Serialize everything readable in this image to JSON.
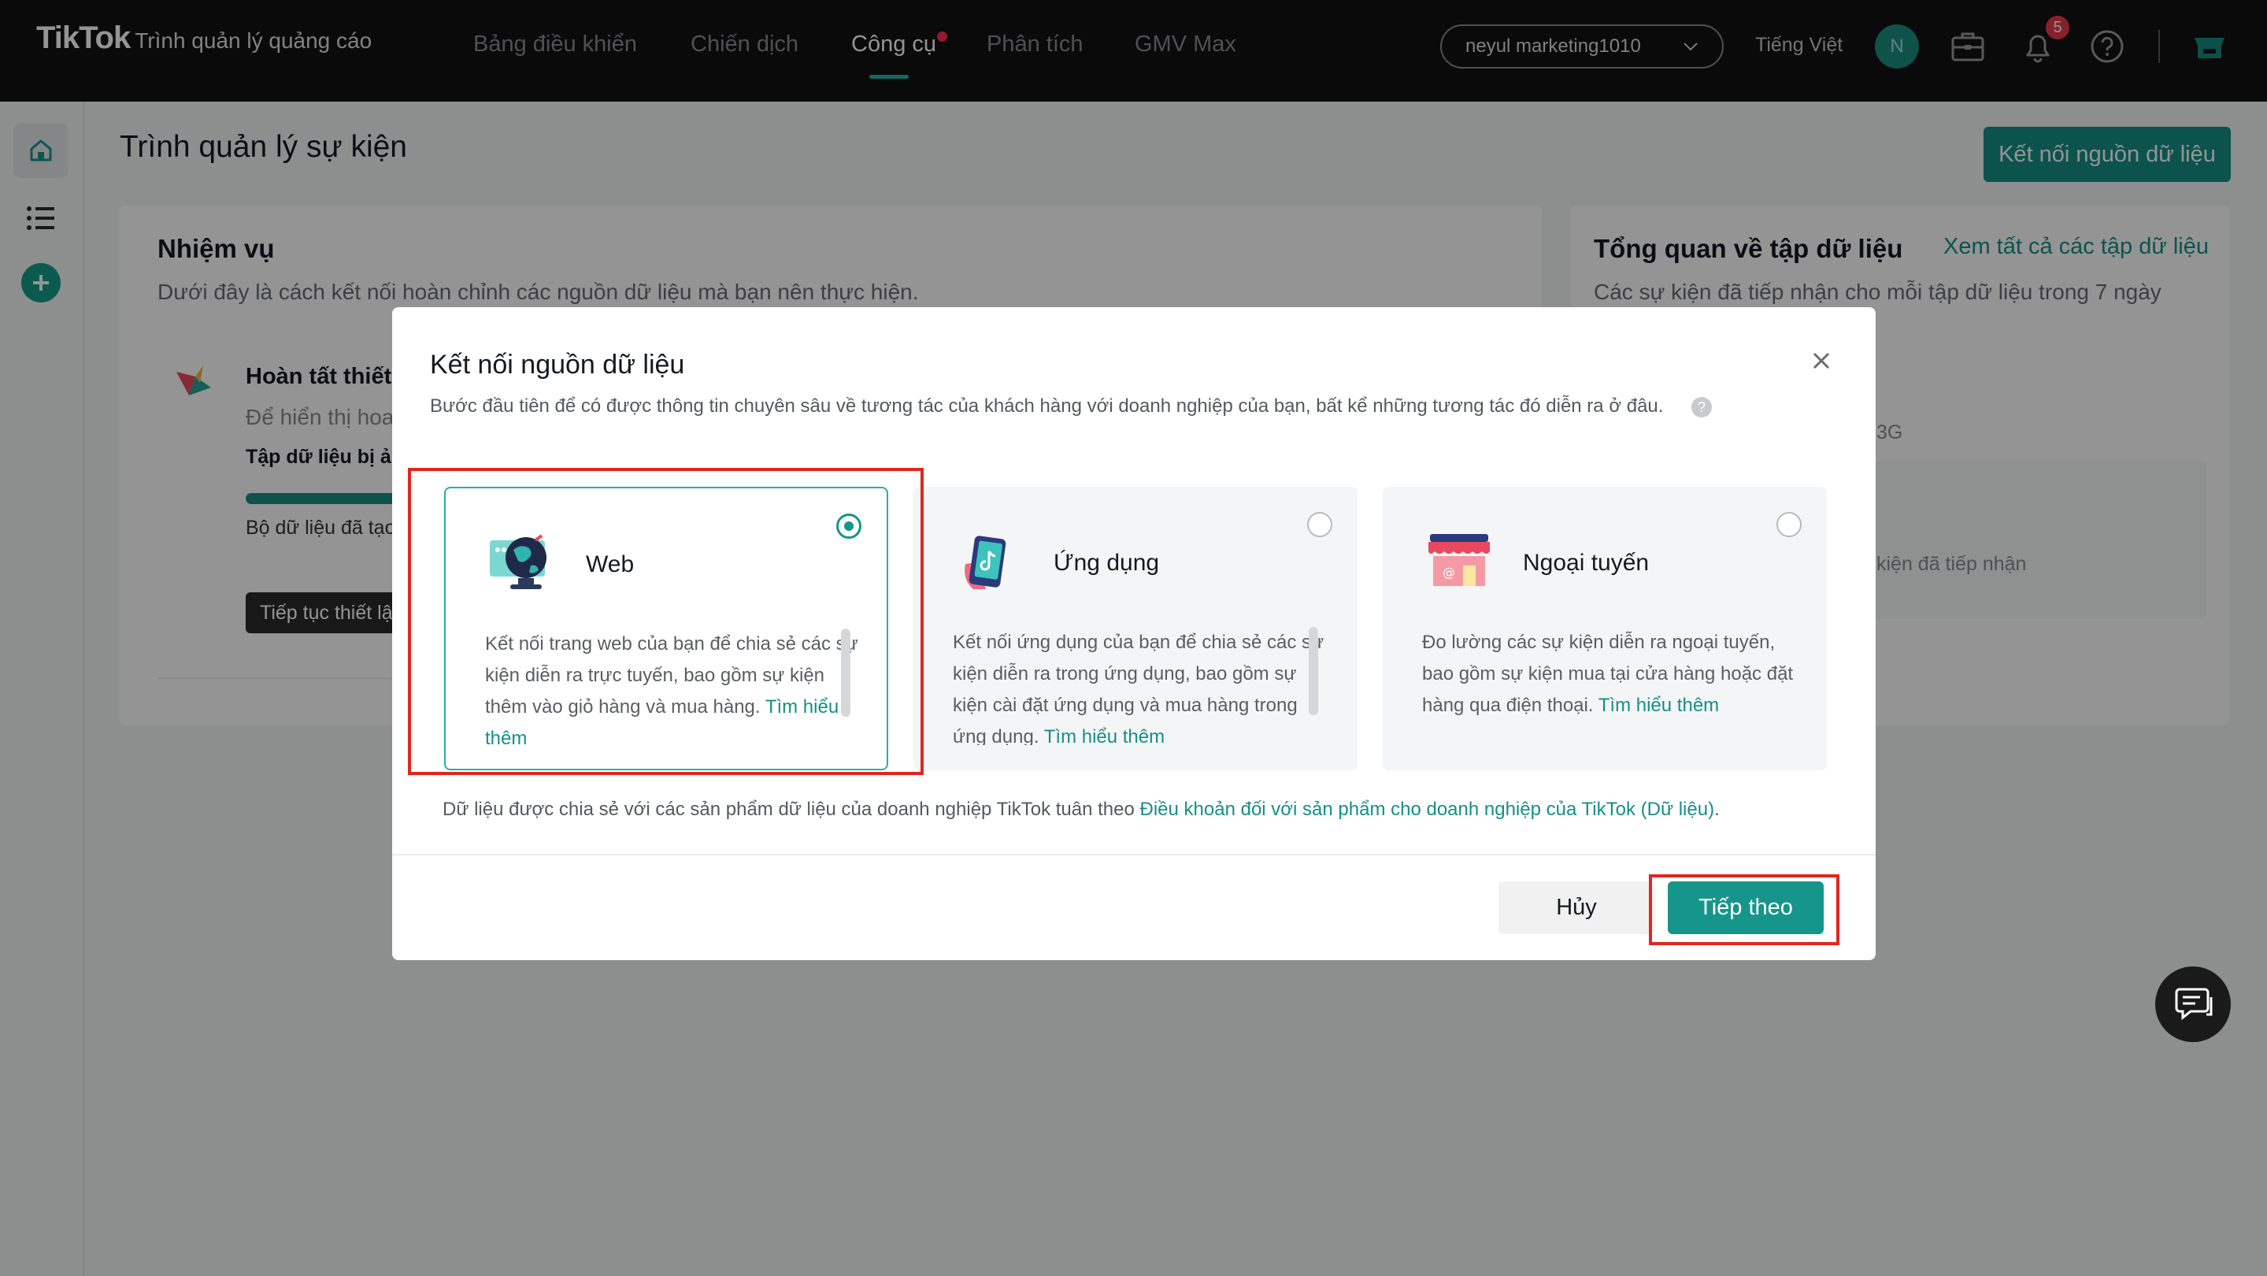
{
  "topbar": {
    "logo": "TikTok",
    "logo_sub": "Trình quản lý quảng cáo",
    "nav": [
      "Bảng điều khiển",
      "Chiến dịch",
      "Công cụ",
      "Phân tích",
      "GMV Max"
    ],
    "active_nav": "Công cụ",
    "account": "neyul marketing1010",
    "language": "Tiếng Việt",
    "avatar_initial": "N",
    "notification_count": "5"
  },
  "page": {
    "title": "Trình quản lý sự kiện",
    "connect_button": "Kết nối nguồn dữ liệu"
  },
  "tasks": {
    "title": "Nhiệm vụ",
    "subtitle": "Dưới đây là cách kết nối hoàn chỉnh các nguồn dữ liệu mà bạn nên thực hiện.",
    "item_title": "Hoàn tất thiết",
    "item_sub": "Để hiển thị hoa",
    "item_dataset": "Tập dữ liệu bị ản",
    "item_created": "Bộ dữ liệu đã tạo",
    "item_continue": "Tiếp tục thiết lậ"
  },
  "overview": {
    "title": "Tổng quan về tập dữ liệu",
    "link": "Xem tất cả các tập dữ liệu",
    "subtitle": "Các sự kiện đã tiếp nhận cho mỗi tập dữ liệu trong 7 ngày",
    "frag_1": "3G",
    "frag_2": "kiện đã tiếp nhận"
  },
  "modal": {
    "title": "Kết nối nguồn dữ liệu",
    "description": "Bước đầu tiên để có được thông tin chuyên sâu về tương tác của khách hàng với doanh nghiệp của bạn, bất kể những tương tác đó diễn ra ở đâu.",
    "help": "?",
    "options": [
      {
        "title": "Web",
        "desc": "Kết nối trang web của bạn để chia sẻ các sự kiện diễn ra trực tuyến, bao gồm sự kiện thêm vào giỏ hàng và mua hàng.",
        "link": "Tìm hiểu thêm",
        "selected": true
      },
      {
        "title": "Ứng dụng",
        "desc": "Kết nối ứng dụng của bạn để chia sẻ các sự kiện diễn ra trong ứng dụng, bao gồm sự kiện cài đặt ứng dụng và mua hàng trong ứng dụng.",
        "link": "Tìm hiểu thêm",
        "selected": false
      },
      {
        "title": "Ngoại tuyến",
        "desc": "Đo lường các sự kiện diễn ra ngoại tuyến, bao gồm sự kiện mua tại cửa hàng hoặc đặt hàng qua điện thoại.",
        "link": "Tìm hiểu thêm",
        "selected": false
      }
    ],
    "terms_prefix": "Dữ liệu được chia sẻ với các sản phẩm dữ liệu của doanh nghiệp TikTok tuân theo",
    "terms_link": "Điều khoản đối với sản phẩm cho doanh nghiệp của TikTok (Dữ liệu)",
    "terms_suffix": ".",
    "cancel": "Hủy",
    "next": "Tiếp theo"
  },
  "colors": {
    "accent": "#16958b",
    "highlight": "#e0271f",
    "topbar": "#121212"
  },
  "icons": [
    "home-icon",
    "list-icon",
    "plus-icon",
    "briefcase-icon",
    "bell-icon",
    "help-icon",
    "shop-icon",
    "close-icon",
    "chat-icon",
    "chevron-down-icon"
  ]
}
